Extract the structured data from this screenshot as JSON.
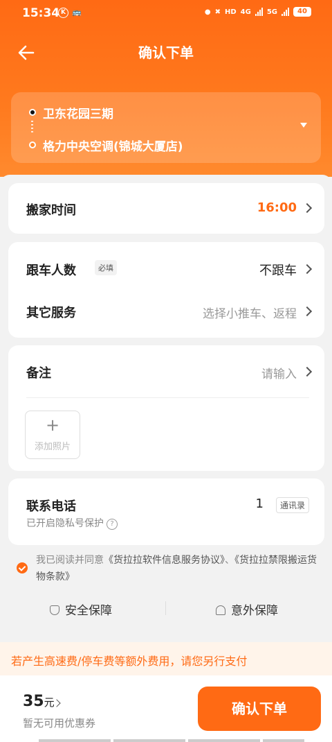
{
  "status_bar": {
    "time": "15:34",
    "k_icon": "K",
    "bus_icon": "bus-icon",
    "hd": "HD",
    "net_4g": "4G",
    "net_5g": "5G",
    "battery": "40"
  },
  "nav": {
    "title": "确认下单"
  },
  "route": {
    "from": "卫东花园三期",
    "to": "格力中央空调(锦城大厦店)"
  },
  "move_time": {
    "label": "搬家时间",
    "value": "16:00"
  },
  "follow": {
    "label": "跟车人数",
    "badge": "必填",
    "value": "不跟车"
  },
  "other_service": {
    "label": "其它服务",
    "placeholder": "选择小推车、返程"
  },
  "remark": {
    "label": "备注",
    "placeholder": "请输入",
    "add_photo_icon": "+",
    "add_photo_label": "添加照片"
  },
  "contact": {
    "label": "联系电话",
    "number": "1",
    "address_book": "通讯录",
    "privacy": "已开启隐私号保护",
    "help_icon": "?"
  },
  "agreement": {
    "prefix": "我已阅读并同意",
    "link1": "《货拉拉软件信息服务协议》",
    "sep": "、",
    "link2": "《货拉拉禁限搬运货物条款》"
  },
  "assurance": {
    "safety": "安全保障",
    "accident": "意外保障"
  },
  "notice": "若产生高速费/停车费等额外费用，请您另行支付",
  "bottom": {
    "price": "35",
    "price_unit": "元",
    "coupon": "暂无可用优惠券",
    "confirm": "确认下单"
  },
  "colors": {
    "accent": "#ff6a14"
  }
}
